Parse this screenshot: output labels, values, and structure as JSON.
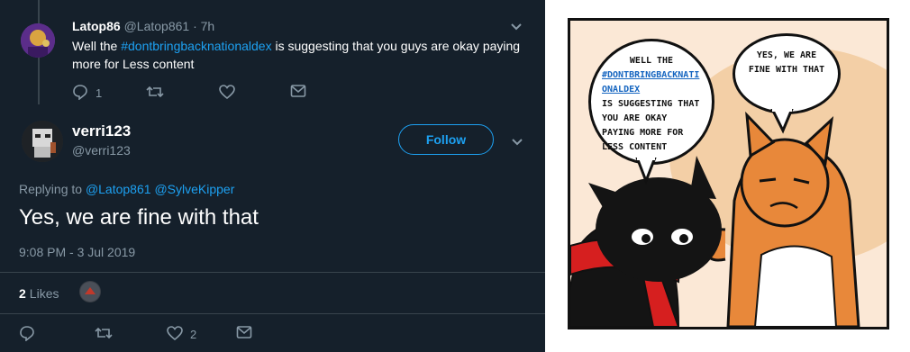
{
  "tweet1": {
    "name": "Latop86",
    "handle": "@Latop861",
    "sep": "·",
    "time": "7h",
    "text_pre": "Well the ",
    "hashtag": "#dontbringbacknationaldex",
    "text_post": " is suggesting that you guys are okay paying more for Less content",
    "reply_count": "1"
  },
  "tweet2": {
    "name": "verri123",
    "handle": "@verri123",
    "follow_label": "Follow",
    "replying_label": "Replying to",
    "replying_to_1": "@Latop861",
    "replying_to_2": "@SylveKipper",
    "text": "Yes, we are fine with that",
    "timestamp": "9:08 PM - 3 Jul 2019",
    "likes_count": "2",
    "likes_label": "Likes",
    "like_action_count": "2"
  },
  "comic": {
    "bubble1_line1": "Well the",
    "bubble1_link": "#dontbringbacknationaldex",
    "bubble1_rest": "is suggesting that you are okay paying more for less content",
    "bubble2": "Yes, we are fine with that"
  },
  "icons": {
    "reply": "reply-icon",
    "retweet": "retweet-icon",
    "like": "heart-icon",
    "dm": "mail-icon",
    "chevron": "chevron-down-icon"
  },
  "colors": {
    "background": "#15202b",
    "accent": "#1da1f2",
    "muted": "#8899a6",
    "divider": "#38444d"
  }
}
